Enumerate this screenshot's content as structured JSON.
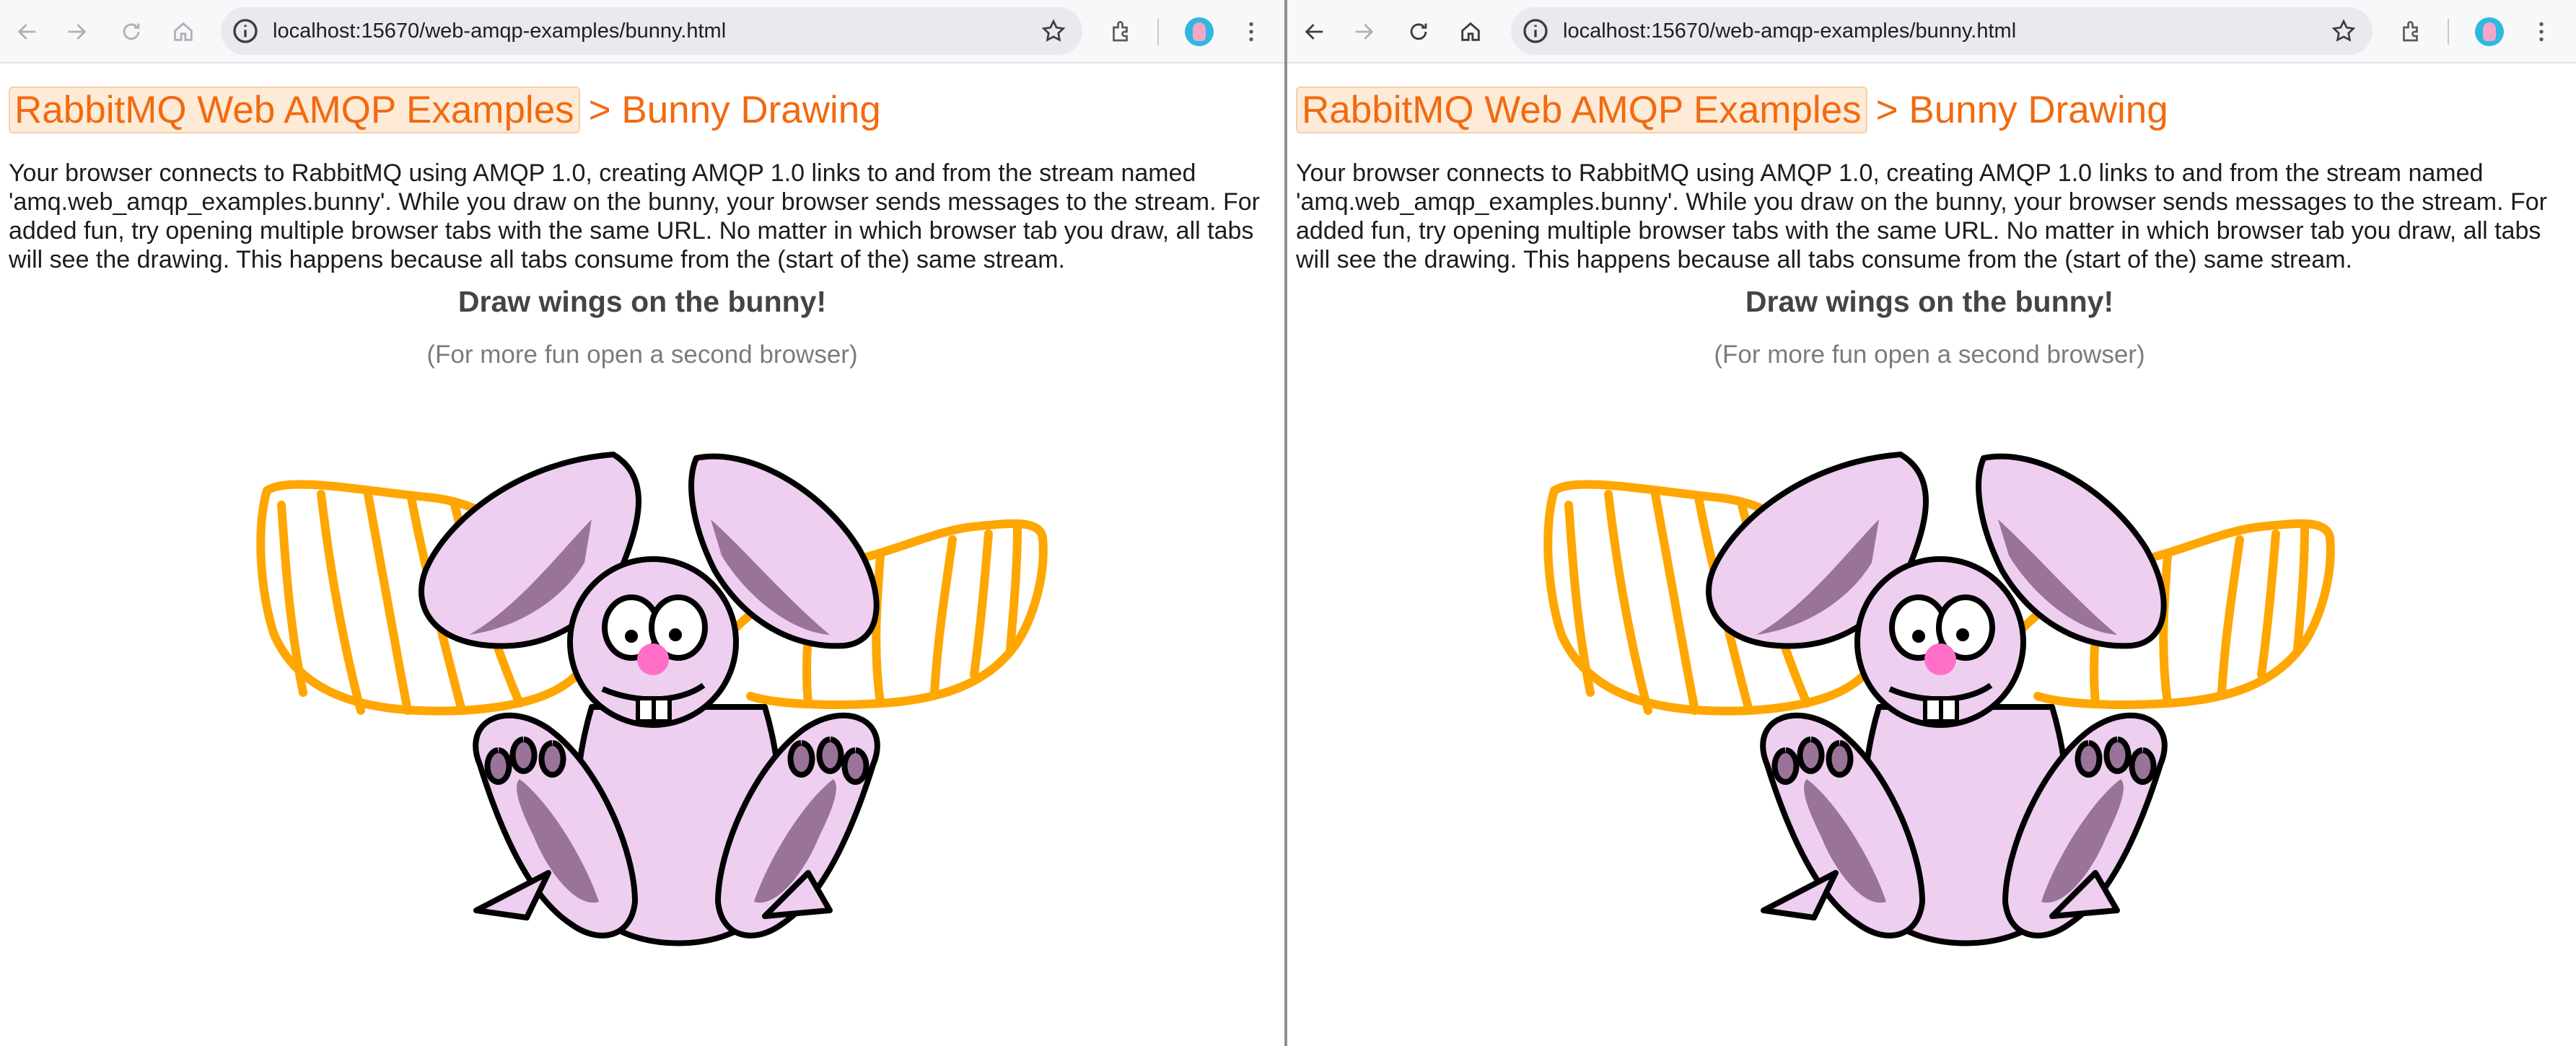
{
  "browser": {
    "url": "localhost:15670/web-amqp-examples/bunny.html",
    "avatar_color": "#2fb8e0",
    "icons": [
      "back-icon",
      "forward-icon",
      "reload-icon",
      "home-icon",
      "site-info-icon",
      "bookmark-star-icon",
      "extensions-icon",
      "menu-icon"
    ]
  },
  "page": {
    "home_link": "RabbitMQ Web AMQP Examples",
    "breadcrumb": "> Bunny Drawing",
    "intro": "Your browser connects to RabbitMQ using AMQP 1.0, creating AMQP 1.0 links to and from the stream named 'amq.web_amqp_examples.bunny'. While you draw on the bunny, your browser sends messages to the stream. For added fun, try opening multiple browser tabs with the same URL. No matter in which browser tab you draw, all tabs will see the drawing. This happens because all tabs consume from the (start of the) same stream.",
    "draw_title": "Draw wings on the bunny!",
    "draw_subtitle": "(For more fun open a second browser)"
  },
  "colors": {
    "accent": "#f26a0f",
    "wing_stroke": "#ffa600",
    "bunny_fill": "#eecff0",
    "bunny_shade": "#9a7398",
    "nose": "#ff6fc8"
  }
}
